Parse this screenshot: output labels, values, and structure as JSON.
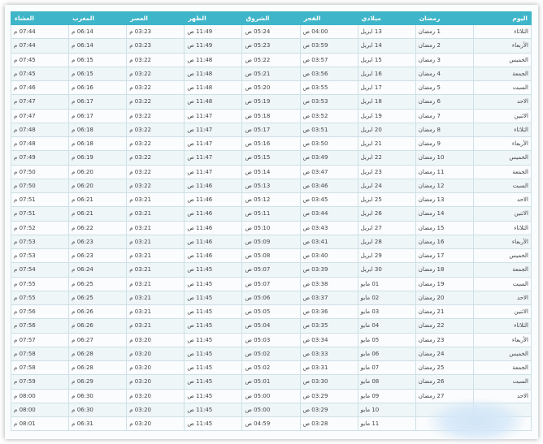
{
  "headers": [
    "اليوم",
    "رمضان",
    "ميلادي",
    "الفجر",
    "الشروق",
    "الظهر",
    "العصر",
    "المغرب",
    "العشاء"
  ],
  "rows": [
    [
      "الثلاثاء",
      "1 رمضان",
      "13 ابريل",
      "04:00 ص",
      "05:24 ص",
      "11:49 ص",
      "03:23 م",
      "06:14 م",
      "07:44 م"
    ],
    [
      "الأربعاء",
      "2 رمضان",
      "14 ابريل",
      "03:59 ص",
      "05:23 ص",
      "11:49 ص",
      "03:23 م",
      "06:14 م",
      "07:44 م"
    ],
    [
      "الخميس",
      "3 رمضان",
      "15 ابريل",
      "03:57 ص",
      "05:22 ص",
      "11:48 ص",
      "03:22 م",
      "06:15 م",
      "07:45 م"
    ],
    [
      "الجمعة",
      "4 رمضان",
      "16 ابريل",
      "03:56 ص",
      "05:21 ص",
      "11:48 ص",
      "03:22 م",
      "06:15 م",
      "07:45 م"
    ],
    [
      "السبت",
      "5 رمضان",
      "17 ابريل",
      "03:55 ص",
      "05:20 ص",
      "11:48 ص",
      "03:22 م",
      "06:16 م",
      "07:46 م"
    ],
    [
      "الاحد",
      "6 رمضان",
      "18 ابريل",
      "03:53 ص",
      "05:19 ص",
      "11:48 ص",
      "03:22 م",
      "06:17 م",
      "07:47 م"
    ],
    [
      "الاثنين",
      "7 رمضان",
      "19 ابريل",
      "03:52 ص",
      "05:18 ص",
      "11:47 ص",
      "03:22 م",
      "06:17 م",
      "07:47 م"
    ],
    [
      "الثلاثاء",
      "8 رمضان",
      "20 ابريل",
      "03:51 ص",
      "05:17 ص",
      "11:47 ص",
      "03:22 م",
      "06:18 م",
      "07:48 م"
    ],
    [
      "الأربعاء",
      "9 رمضان",
      "21 ابريل",
      "03:50 ص",
      "05:16 ص",
      "11:47 ص",
      "03:22 م",
      "06:18 م",
      "07:48 م"
    ],
    [
      "الخميس",
      "10 رمضان",
      "22 ابريل",
      "03:49 ص",
      "05:15 ص",
      "11:47 ص",
      "03:22 م",
      "06:19 م",
      "07:49 م"
    ],
    [
      "الجمعة",
      "11 رمضان",
      "23 ابريل",
      "03:47 ص",
      "05:14 ص",
      "11:47 ص",
      "03:22 م",
      "06:20 م",
      "07:50 م"
    ],
    [
      "السبت",
      "12 رمضان",
      "24 ابريل",
      "03:46 ص",
      "05:13 ص",
      "11:46 ص",
      "03:22 م",
      "06:20 م",
      "07:50 م"
    ],
    [
      "الاحد",
      "13 رمضان",
      "25 ابريل",
      "03:45 ص",
      "05:12 ص",
      "11:46 ص",
      "03:21 م",
      "06:21 م",
      "07:51 م"
    ],
    [
      "الاثنين",
      "14 رمضان",
      "26 ابريل",
      "03:44 ص",
      "05:11 ص",
      "11:46 ص",
      "03:21 م",
      "06:21 م",
      "07:51 م"
    ],
    [
      "الثلاثاء",
      "15 رمضان",
      "27 ابريل",
      "03:43 ص",
      "05:10 ص",
      "11:46 ص",
      "03:21 م",
      "06:22 م",
      "07:52 م"
    ],
    [
      "الأربعاء",
      "16 رمضان",
      "28 ابريل",
      "03:41 ص",
      "05:09 ص",
      "11:46 ص",
      "03:21 م",
      "06:23 م",
      "07:53 م"
    ],
    [
      "الخميس",
      "17 رمضان",
      "29 ابريل",
      "03:40 ص",
      "05:08 ص",
      "11:46 ص",
      "03:21 م",
      "06:23 م",
      "07:53 م"
    ],
    [
      "الجمعة",
      "18 رمضان",
      "30 ابريل",
      "03:39 ص",
      "05:07 ص",
      "11:45 ص",
      "03:21 م",
      "06:24 م",
      "07:54 م"
    ],
    [
      "السبت",
      "19 رمضان",
      "01 مايو",
      "03:38 ص",
      "05:07 ص",
      "11:45 ص",
      "03:21 م",
      "06:25 م",
      "07:55 م"
    ],
    [
      "الاحد",
      "20 رمضان",
      "02 مايو",
      "03:37 ص",
      "05:06 ص",
      "11:45 ص",
      "03:21 م",
      "06:25 م",
      "07:55 م"
    ],
    [
      "الاثنين",
      "21 رمضان",
      "03 مايو",
      "03:36 ص",
      "05:05 ص",
      "11:45 ص",
      "03:21 م",
      "06:26 م",
      "07:56 م"
    ],
    [
      "الثلاثاء",
      "22 رمضان",
      "04 مايو",
      "03:35 ص",
      "05:04 ص",
      "11:45 ص",
      "03:21 م",
      "06:26 م",
      "07:56 م"
    ],
    [
      "الأربعاء",
      "23 رمضان",
      "05 مايو",
      "03:34 ص",
      "05:03 ص",
      "11:45 ص",
      "03:20 م",
      "06:27 م",
      "07:57 م"
    ],
    [
      "الخميس",
      "24 رمضان",
      "06 مايو",
      "03:33 ص",
      "05:02 ص",
      "11:45 ص",
      "03:20 م",
      "06:28 م",
      "07:58 م"
    ],
    [
      "الجمعة",
      "25 رمضان",
      "07 مايو",
      "03:31 ص",
      "05:02 ص",
      "11:45 ص",
      "03:20 م",
      "06:28 م",
      "07:58 م"
    ],
    [
      "السبت",
      "26 رمضان",
      "08 مايو",
      "03:30 ص",
      "05:01 ص",
      "11:45 ص",
      "03:20 م",
      "06:29 م",
      "07:59 م"
    ],
    [
      "الاحد",
      "27 رمضان",
      "09 مايو",
      "03:29 ص",
      "05:00 ص",
      "11:45 ص",
      "03:20 م",
      "06:30 م",
      "08:00 م"
    ],
    [
      "",
      "",
      "10 مايو",
      "03:29 ص",
      "05:00 ص",
      "11:45 ص",
      "03:20 م",
      "06:30 م",
      "08:00 م"
    ],
    [
      "",
      "",
      "11 مايو",
      "03:28 ص",
      "04:59 ص",
      "11:45 ص",
      "03:20 م",
      "06:31 م",
      "08:01 م"
    ]
  ],
  "colors": {
    "header_bg": "#3fb5c9",
    "row_alt": "#eef6f8",
    "border": "#cfe0e6"
  }
}
